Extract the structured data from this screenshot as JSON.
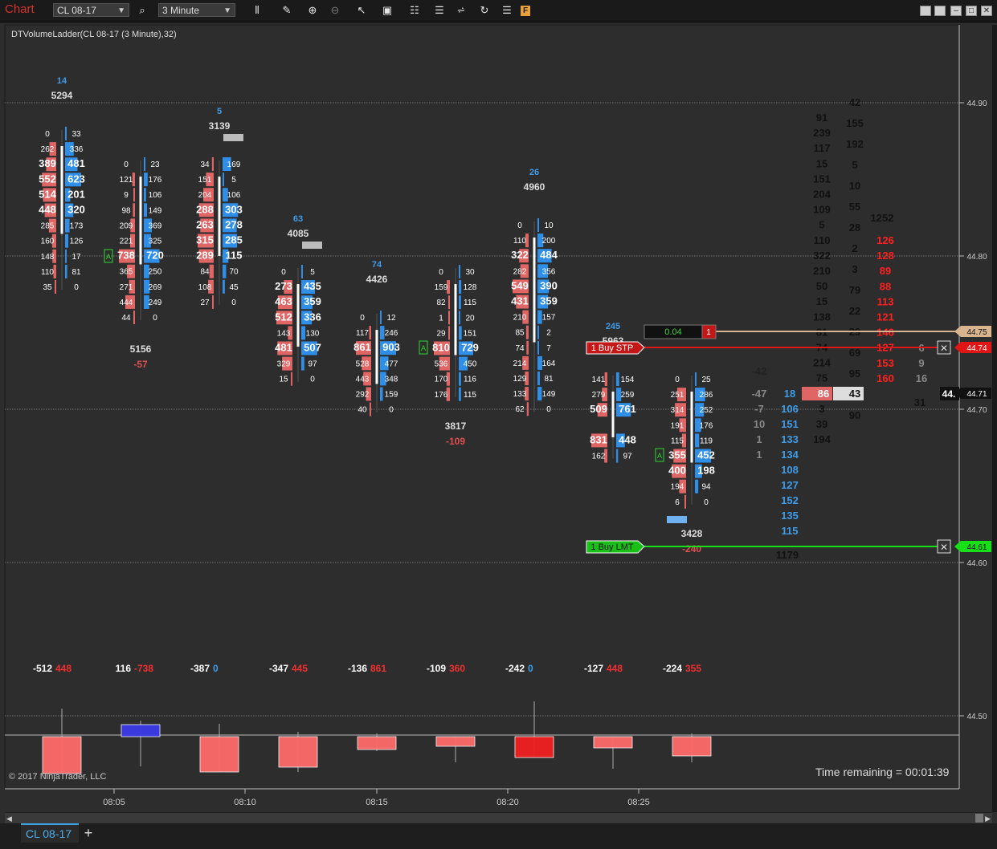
{
  "window": {
    "title": "Chart"
  },
  "toolbar": {
    "instrument": "CL 08-17",
    "timeframe": "3 Minute",
    "f_label": "F"
  },
  "indicator_label": "DTVolumeLadder(CL 08-17 (3 Minute),32)",
  "copyright": "© 2017 NinjaTrader, LLC",
  "time_remaining": "Time remaining = 00:01:39",
  "tab": {
    "label": "CL 08-17",
    "add": "+"
  },
  "colors": {
    "bid": "#e06666",
    "ask": "#2f8fe8",
    "bull": "#3a3ae8",
    "bear": "#f23030",
    "buy_stp": "#e01616",
    "buy_lmt": "#18e018",
    "line_4475": "#d9b58f"
  },
  "orders": {
    "stop_label": "1  Buy STP",
    "limit_label": "1  Buy LMT",
    "pnl_value": "0.04",
    "pnl_qty": "1"
  },
  "price_axis": {
    "ticks": [
      "44.90",
      "44.80",
      "44.70",
      "44.60",
      "44.50"
    ],
    "markers": {
      "p4475": "44.75",
      "p4474": "44.74",
      "p4471": "44.71",
      "p4461": "44.61",
      "cut": "44."
    }
  },
  "time_axis": [
    "08:05",
    "08:10",
    "08:15",
    "08:20",
    "08:25"
  ],
  "chart_data": {
    "type": "volume-ladder",
    "bars": [
      {
        "time": "08:03",
        "delta_head": "14",
        "vol_head": "5294",
        "delta_foot": "-512",
        "footnote": "448",
        "ladder": [
          [
            "0",
            "33"
          ],
          [
            "262",
            "336"
          ],
          [
            "389",
            "481"
          ],
          [
            "552",
            "623"
          ],
          [
            "514",
            "201"
          ],
          [
            "448",
            "320"
          ],
          [
            "285",
            "173"
          ],
          [
            "160",
            "126"
          ],
          [
            "148",
            "17"
          ],
          [
            "110",
            "81"
          ],
          [
            "35",
            "0"
          ]
        ]
      },
      {
        "time": "08:06",
        "delta_head": "",
        "vol_head": "",
        "delta_foot": "116",
        "footnote": "-738",
        "mid_total": "5156",
        "mid_delta": "-57",
        "ladder": [
          [
            "0",
            "23"
          ],
          [
            "121",
            "176"
          ],
          [
            "9",
            "106"
          ],
          [
            "98",
            "149"
          ],
          [
            "209",
            "369"
          ],
          [
            "221",
            "325"
          ],
          [
            "738",
            "720"
          ],
          [
            "365",
            "250"
          ],
          [
            "271",
            "269"
          ],
          [
            "444",
            "249"
          ],
          [
            "44",
            "0"
          ]
        ]
      },
      {
        "time": "08:09",
        "delta_head": "5",
        "vol_head": "3139",
        "delta_foot": "-387",
        "footnote": "0",
        "ladder": [
          [
            "34",
            "169"
          ],
          [
            "151",
            "5"
          ],
          [
            "204",
            "106"
          ],
          [
            "288",
            "303"
          ],
          [
            "263",
            "278"
          ],
          [
            "315",
            "285"
          ],
          [
            "289",
            "115"
          ],
          [
            "84",
            "70"
          ],
          [
            "108",
            "45"
          ],
          [
            "27",
            "0"
          ]
        ]
      },
      {
        "time": "08:12",
        "delta_head": "63",
        "vol_head": "4085",
        "delta_foot": "-347",
        "footnote": "445",
        "ladder": [
          [
            "0",
            "5"
          ],
          [
            "273",
            "435"
          ],
          [
            "463",
            "359"
          ],
          [
            "512",
            "336"
          ],
          [
            "143",
            "130"
          ],
          [
            "481",
            "507"
          ],
          [
            "329",
            "97"
          ],
          [
            "15",
            "0"
          ]
        ]
      },
      {
        "time": "08:15",
        "delta_head": "74",
        "vol_head": "4426",
        "delta_foot": "-136",
        "footnote": "861",
        "ladder": [
          [
            "0",
            "12"
          ],
          [
            "117",
            "246"
          ],
          [
            "861",
            "903"
          ],
          [
            "528",
            "477"
          ],
          [
            "443",
            "348"
          ],
          [
            "292",
            "159"
          ],
          [
            "40",
            "0"
          ]
        ]
      },
      {
        "time": "08:18",
        "delta_head": "",
        "vol_head": "",
        "delta_foot": "-109",
        "footnote": "360",
        "mid_total": "3817",
        "mid_delta": "-109",
        "ladder": [
          [
            "0",
            "30"
          ],
          [
            "159",
            "128"
          ],
          [
            "82",
            "115"
          ],
          [
            "1",
            "20"
          ],
          [
            "29",
            "151"
          ],
          [
            "810",
            "729"
          ],
          [
            "536",
            "450"
          ],
          [
            "170",
            "116"
          ],
          [
            "176",
            "115"
          ]
        ]
      },
      {
        "time": "08:21",
        "delta_head": "26",
        "vol_head": "4960",
        "delta_foot": "-242",
        "footnote": "0",
        "ladder": [
          [
            "0",
            "10"
          ],
          [
            "110",
            "200"
          ],
          [
            "322",
            "484"
          ],
          [
            "282",
            "356"
          ],
          [
            "549",
            "390"
          ],
          [
            "431",
            "359"
          ],
          [
            "210",
            "157"
          ],
          [
            "85",
            "2"
          ],
          [
            "74",
            "7"
          ],
          [
            "214",
            "164"
          ],
          [
            "129",
            "81"
          ],
          [
            "133",
            "149"
          ],
          [
            "62",
            "0"
          ]
        ]
      },
      {
        "time": "08:24",
        "delta_head": "245",
        "vol_head": "5963",
        "delta_foot": "-127",
        "footnote": "448",
        "ladder": [
          [
            "141",
            "154"
          ],
          [
            "279",
            "259"
          ],
          [
            "509",
            "761"
          ],
          [
            "",
            ""
          ],
          [
            "831",
            "448"
          ],
          [
            "162",
            "97"
          ]
        ]
      },
      {
        "time": "08:27",
        "delta_head": "",
        "vol_head": "",
        "delta_foot": "-224",
        "footnote": "355",
        "mid_total": "3428",
        "mid_delta": "-240",
        "ladder": [
          [
            "0",
            "25"
          ],
          [
            "251",
            "286"
          ],
          [
            "314",
            "252"
          ],
          [
            "191",
            "176"
          ],
          [
            "115",
            "119"
          ],
          [
            "355",
            "452"
          ],
          [
            "400",
            "198"
          ],
          [
            "194",
            "94"
          ],
          [
            "6",
            "0"
          ]
        ]
      }
    ],
    "dom": {
      "col_bid_gray": [
        "-42",
        "-47",
        "-7",
        "10",
        "1",
        "1"
      ],
      "col_blue": [
        "18",
        "106",
        "151",
        "133",
        "134",
        "108",
        "127",
        "152",
        "135",
        "115"
      ],
      "col_bid": [
        "91",
        "239",
        "117",
        "15",
        "151",
        "204",
        "109",
        "5",
        "110",
        "322",
        "210",
        "50",
        "15",
        "138",
        "81",
        "74",
        "214",
        "75",
        "29",
        "3",
        "39",
        "194"
      ],
      "col_ask": [
        "42",
        "155",
        "192",
        "5",
        "10",
        "55",
        "28",
        "2",
        "3",
        "79",
        "22",
        "29",
        "69",
        "95",
        "94",
        "90"
      ],
      "col_red": [
        "1252",
        "126",
        "128",
        "89",
        "88",
        "113",
        "121",
        "146",
        "127",
        "153",
        "160"
      ],
      "col_gray": [
        "6",
        "9",
        "16",
        "31"
      ],
      "inside_bid": "86",
      "inside_ask": "43",
      "total_bottom": "1179"
    }
  }
}
